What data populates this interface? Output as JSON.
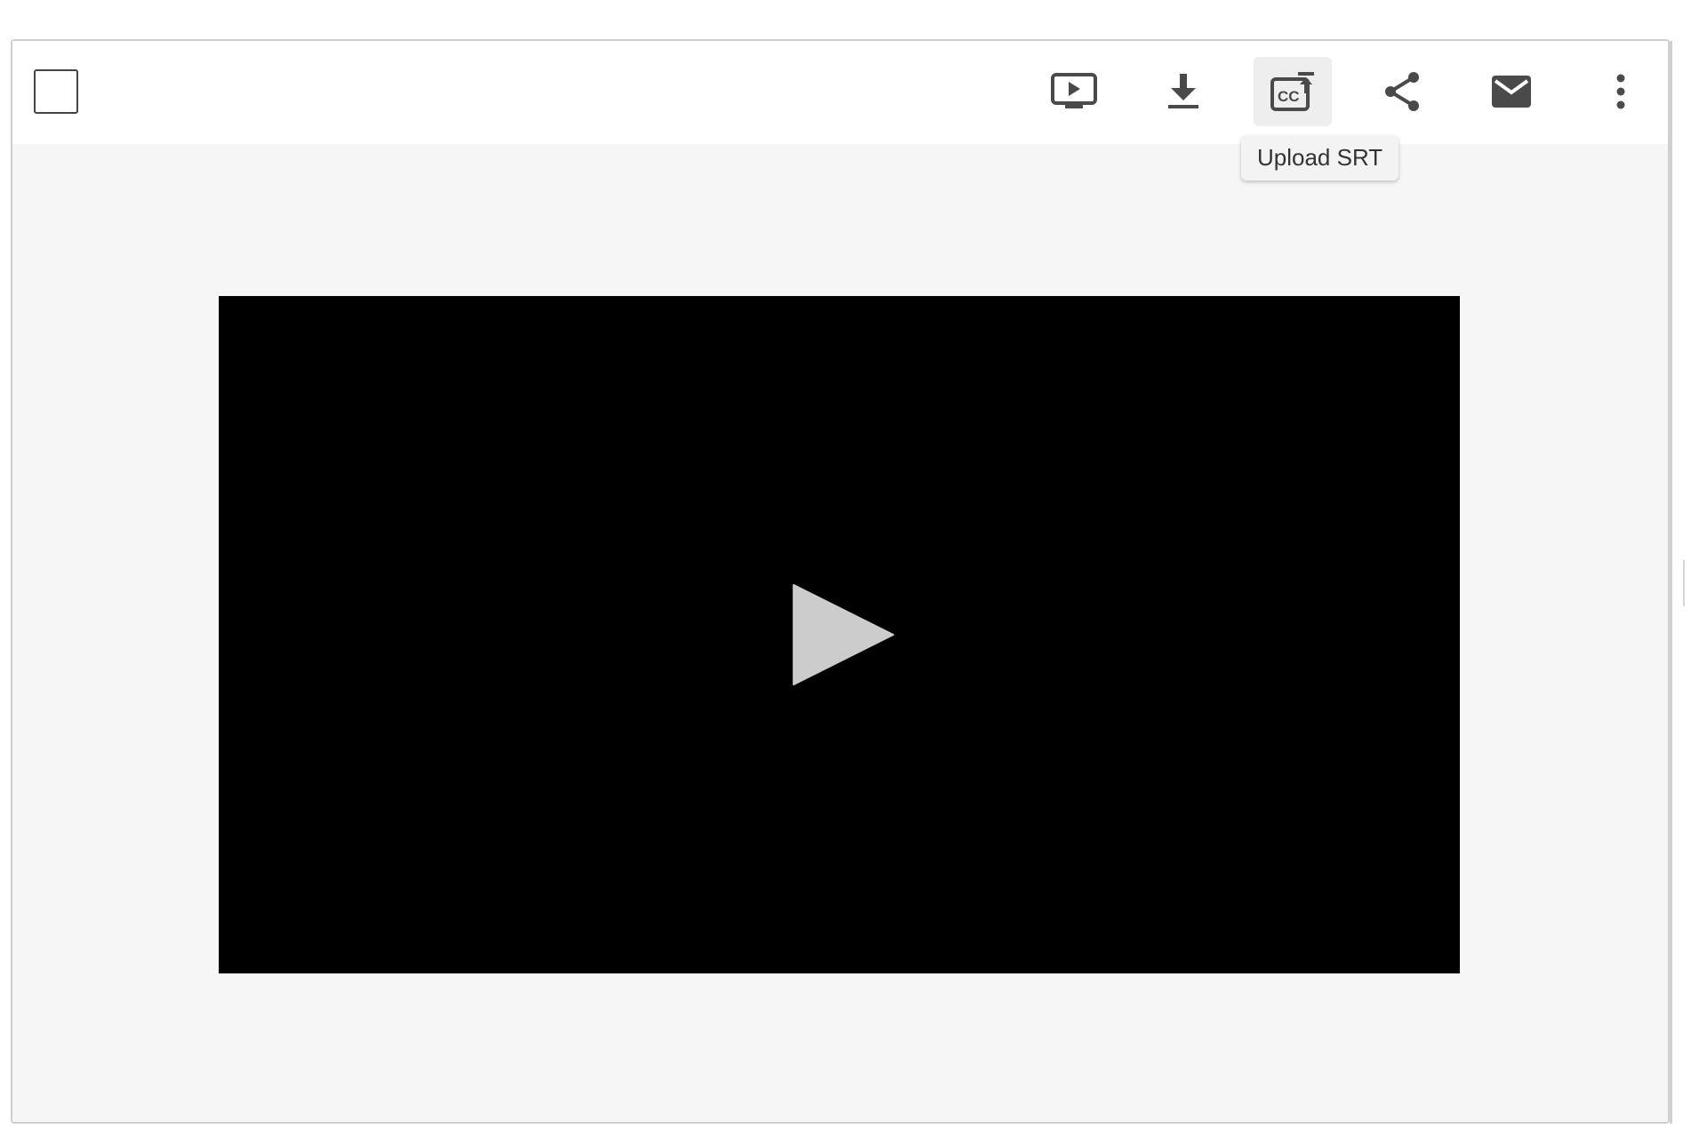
{
  "toolbar": {
    "select_checkbox": {
      "checked": false
    },
    "buttons": [
      {
        "id": "present",
        "icon": "present-to-all-icon"
      },
      {
        "id": "download",
        "icon": "download-icon"
      },
      {
        "id": "upload-srt",
        "icon": "closed-caption-upload-icon",
        "active": true
      },
      {
        "id": "share",
        "icon": "share-icon"
      },
      {
        "id": "email",
        "icon": "mail-icon"
      },
      {
        "id": "more",
        "icon": "more-vertical-icon"
      }
    ],
    "tooltip": "Upload SRT"
  },
  "video": {
    "play_icon": "play-icon",
    "background": "#000000",
    "play_color": "#cccccc"
  },
  "colors": {
    "icon": "#4a4a4a",
    "content_bg": "#f6f6f6",
    "toolbar_bg": "#ffffff",
    "active_button_bg": "#eeeeee"
  }
}
